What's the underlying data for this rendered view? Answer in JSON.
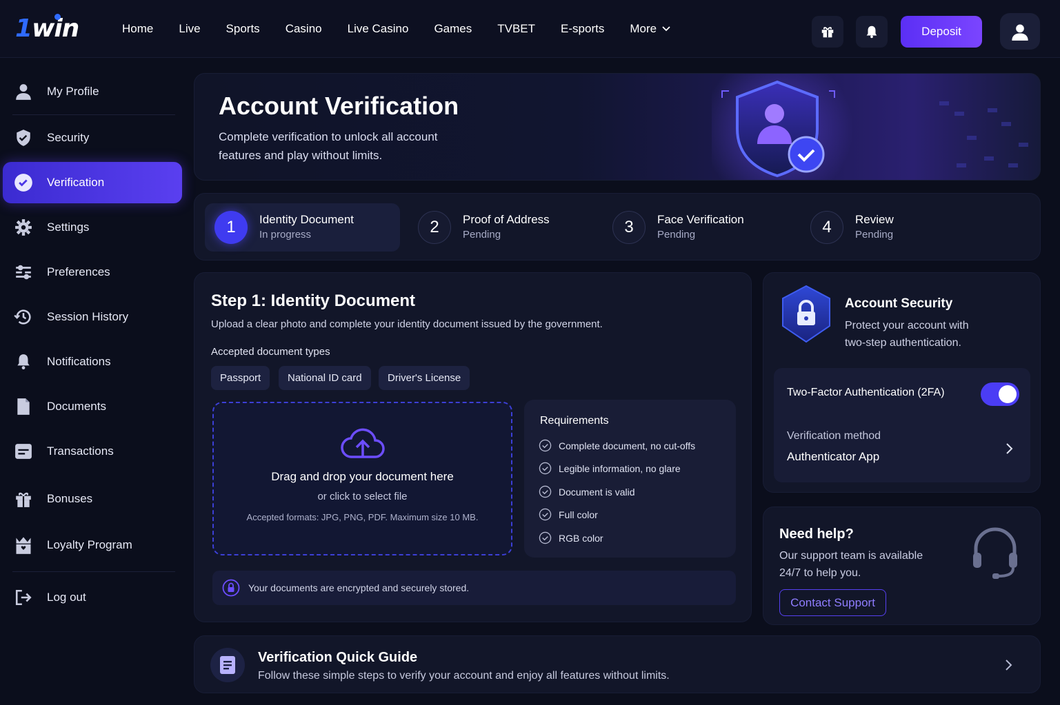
{
  "brand": {
    "logo_text_a": "1",
    "logo_text_b": "win"
  },
  "nav": {
    "items": [
      "Home",
      "Live",
      "Sports",
      "Casino",
      "Live Casino",
      "Games",
      "TVBET",
      "E-sports",
      "More"
    ],
    "deposit_label": "Deposit"
  },
  "sidebar": {
    "items": [
      {
        "label": "My Profile",
        "icon": "user-icon"
      },
      {
        "label": "Security",
        "icon": "shield-icon"
      },
      {
        "label": "Verification",
        "icon": "check-circle-icon",
        "active": true
      },
      {
        "label": "Settings",
        "icon": "gear-icon"
      },
      {
        "label": "Preferences",
        "icon": "sliders-icon"
      },
      {
        "label": "Session History",
        "icon": "history-icon"
      },
      {
        "label": "Notifications",
        "icon": "bell-icon"
      },
      {
        "label": "Documents",
        "icon": "document-icon"
      },
      {
        "label": "Transactions",
        "icon": "card-icon"
      },
      {
        "label": "Bonuses",
        "icon": "gift-icon"
      },
      {
        "label": "Loyalty Program",
        "icon": "crown-gift-icon"
      }
    ],
    "logout_label": "Log out"
  },
  "hero": {
    "title": "Account Verification",
    "subtitle": "Complete verification to unlock all account features and play without limits."
  },
  "steps": [
    {
      "num": "1",
      "title": "Identity Document",
      "status": "In progress"
    },
    {
      "num": "2",
      "title": "Proof of Address",
      "status": "Pending"
    },
    {
      "num": "3",
      "title": "Face Verification",
      "status": "Pending"
    },
    {
      "num": "4",
      "title": "Review",
      "status": "Pending"
    }
  ],
  "main": {
    "title": "Step 1: Identity Document",
    "description": "Upload a clear photo and complete your identity document issued by the government.",
    "accepted_label": "Accepted document types",
    "doc_types": [
      "Passport",
      "National ID card",
      "Driver's License"
    ],
    "drop": {
      "title": "Drag and drop your document here",
      "sub": "or click to select file",
      "formats": "Accepted formats: JPG, PNG, PDF. Maximum size 10 MB."
    },
    "requirements": {
      "title": "Requirements",
      "items": [
        "Complete document, no cut-offs",
        "Legible information, no glare",
        "Document is valid",
        "Full color",
        "RGB color"
      ]
    },
    "secure_note": "Your documents are encrypted and securely stored."
  },
  "account_security": {
    "title": "Account Security",
    "subtitle": "Protect your account with two-step authentication.",
    "twofa_label": "Two-Factor Authentication (2FA)",
    "twofa_enabled": true,
    "method_label": "Verification method",
    "method_value": "Authenticator App"
  },
  "help": {
    "title": "Need help?",
    "subtitle": "Our support team is available 24/7 to help you.",
    "button": "Contact Support"
  },
  "guide": {
    "title": "Verification Quick Guide",
    "subtitle": "Follow these simple steps to verify your account and enjoy all features without limits."
  },
  "colors": {
    "accent": "#5b3ff0",
    "background": "#0b0e1c",
    "panel": "#121629"
  }
}
